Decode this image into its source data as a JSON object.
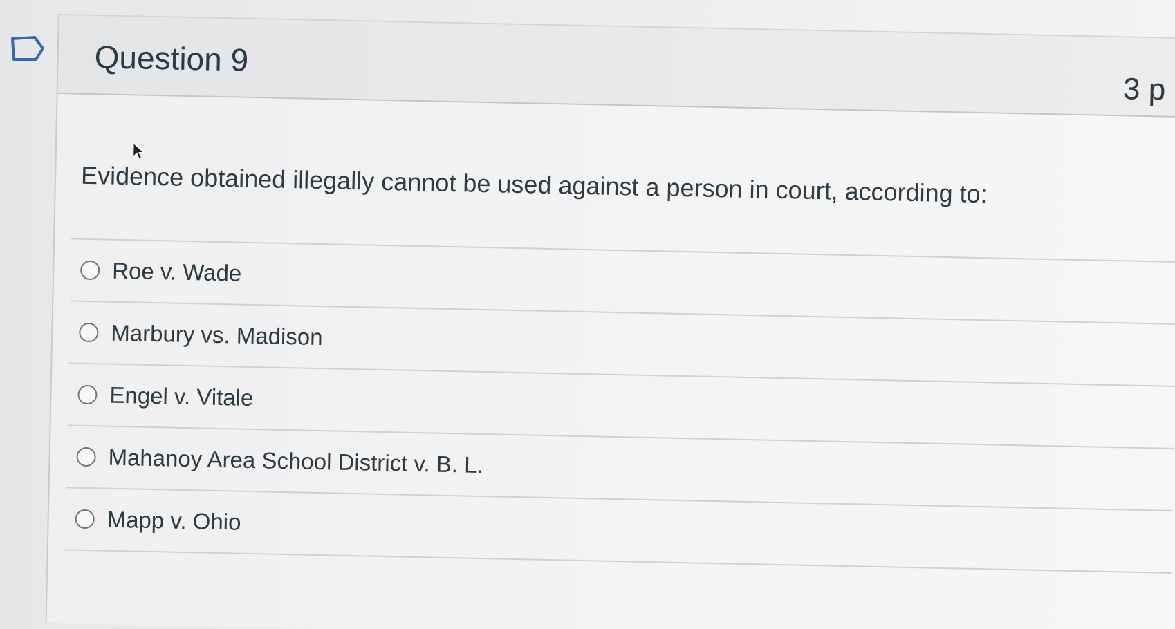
{
  "question": {
    "title": "Question 9",
    "points": "3 p",
    "text": "Evidence obtained illegally cannot be used against a person in court, according to:",
    "answers": [
      {
        "label": "Roe v. Wade"
      },
      {
        "label": "Marbury vs. Madison"
      },
      {
        "label": "Engel v. Vitale"
      },
      {
        "label": "Mahanoy Area School District v. B. L."
      },
      {
        "label": "Mapp v. Ohio"
      }
    ]
  },
  "icons": {
    "flag": "bookmark-flag-icon",
    "cursor": "mouse-pointer-icon",
    "radio": "radio-unchecked-icon"
  },
  "colors": {
    "text": "#2d3b45",
    "divider": "#cdd1d4",
    "header_bg": "#e6e7e9"
  }
}
